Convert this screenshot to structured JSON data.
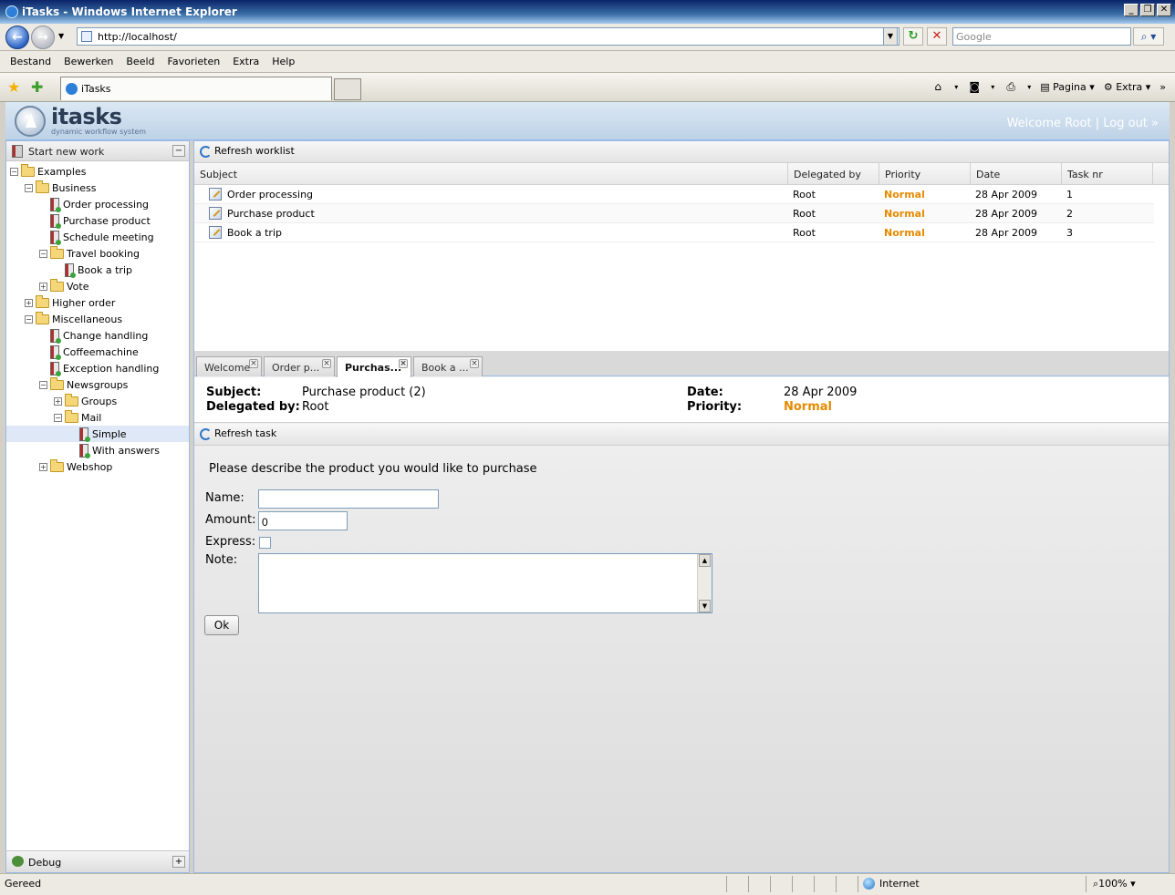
{
  "browser": {
    "window_title": "iTasks - Windows Internet Explorer",
    "url": "http://localhost/",
    "search_placeholder": "Google",
    "menu": [
      "Bestand",
      "Bewerken",
      "Beeld",
      "Favorieten",
      "Extra",
      "Help"
    ],
    "tab_title": "iTasks",
    "cmd_page": "Pagina",
    "cmd_extra": "Extra",
    "status_text": "Gereed",
    "zone": "Internet",
    "zoom": "100%"
  },
  "app": {
    "logo": "itasks",
    "logo_sub": "dynamic workflow system",
    "welcome": "Welcome Root | Log out »"
  },
  "left": {
    "start_new_work": "Start new work",
    "debug": "Debug",
    "tree": [
      {
        "label": "Examples",
        "type": "folder",
        "pm": "-"
      },
      {
        "label": "Business",
        "type": "folder",
        "pm": "-"
      },
      {
        "label": "Order processing",
        "type": "task"
      },
      {
        "label": "Purchase product",
        "type": "task"
      },
      {
        "label": "Schedule meeting",
        "type": "task"
      },
      {
        "label": "Travel booking",
        "type": "folder",
        "pm": "-"
      },
      {
        "label": "Book a trip",
        "type": "task"
      },
      {
        "label": "Vote",
        "type": "folder",
        "pm": "+"
      },
      {
        "label": "Higher order",
        "type": "folder",
        "pm": "+"
      },
      {
        "label": "Miscellaneous",
        "type": "folder",
        "pm": "-"
      },
      {
        "label": "Change handling",
        "type": "task"
      },
      {
        "label": "Coffeemachine",
        "type": "task"
      },
      {
        "label": "Exception handling",
        "type": "task"
      },
      {
        "label": "Newsgroups",
        "type": "folder",
        "pm": "-"
      },
      {
        "label": "Groups",
        "type": "folder",
        "pm": "+"
      },
      {
        "label": "Mail",
        "type": "folder",
        "pm": "-"
      },
      {
        "label": "Simple",
        "type": "task",
        "selected": true
      },
      {
        "label": "With answers",
        "type": "task"
      },
      {
        "label": "Webshop",
        "type": "folder",
        "pm": "+"
      }
    ]
  },
  "worklist": {
    "refresh_label": "Refresh worklist",
    "columns": [
      "Subject",
      "Delegated by",
      "Priority",
      "Date",
      "Task nr"
    ],
    "rows": [
      {
        "subject": "Order processing",
        "delegated_by": "Root",
        "priority": "Normal",
        "date": "28 Apr 2009",
        "task_nr": "1"
      },
      {
        "subject": "Purchase product",
        "delegated_by": "Root",
        "priority": "Normal",
        "date": "28 Apr 2009",
        "task_nr": "2"
      },
      {
        "subject": "Book a trip",
        "delegated_by": "Root",
        "priority": "Normal",
        "date": "28 Apr 2009",
        "task_nr": "3"
      }
    ]
  },
  "tabs": [
    {
      "label": "Welcome"
    },
    {
      "label": "Order p..."
    },
    {
      "label": "Purchas...",
      "active": true
    },
    {
      "label": "Book a ..."
    }
  ],
  "task": {
    "subject_label": "Subject:",
    "subject": "Purchase product (2)",
    "delegated_label": "Delegated by:",
    "delegated": "Root",
    "date_label": "Date:",
    "date": "28 Apr 2009",
    "priority_label": "Priority:",
    "priority": "Normal",
    "refresh_label": "Refresh task"
  },
  "form": {
    "intro": "Please describe the product you would like to purchase",
    "name_label": "Name:",
    "name_value": "",
    "amount_label": "Amount:",
    "amount_value": "0",
    "express_label": "Express:",
    "note_label": "Note:",
    "ok_label": "Ok"
  },
  "colors": {
    "accent": "#99bbe8",
    "priority": "#e68a00",
    "selected_row": "#dfe8f6"
  }
}
